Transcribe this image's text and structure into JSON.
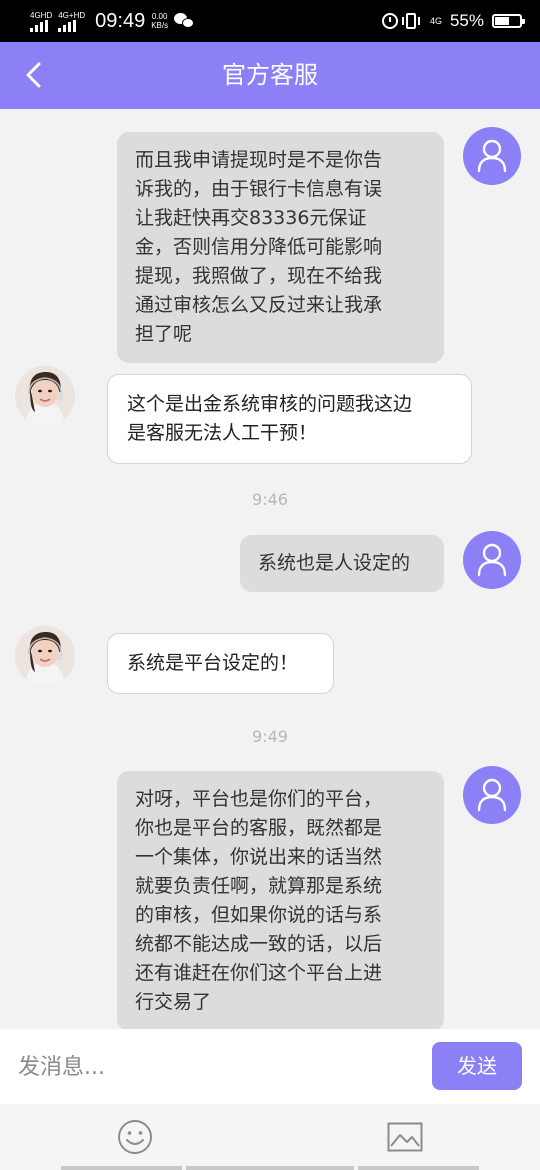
{
  "status_bar": {
    "network1": "4GHD",
    "network2": "4G+HD",
    "time": "09:49",
    "speed_value": "0.00",
    "speed_unit": "KB/s",
    "network_type": "4G",
    "battery_percent": "55%",
    "icons": [
      "signal-icon",
      "wechat-icon",
      "alarm-icon",
      "vibrate-icon",
      "battery-icon"
    ]
  },
  "header": {
    "title": "官方客服",
    "back_icon": "chevron-left-icon"
  },
  "messages": [
    {
      "from": "user",
      "lines": [
        "而且我申请提现时是不是你告",
        "诉我的，由于银行卡信息有误",
        "让我赶快再交83336元保证",
        "金，否则信用分降低可能影响",
        "提现，我照做了，现在不给我",
        "通过审核怎么又反过来让我承",
        "担了呢"
      ]
    },
    {
      "from": "agent",
      "lines": [
        "这个是出金系统审核的问题我这边",
        "是客服无法人工干预！"
      ]
    },
    {
      "time": "9:46"
    },
    {
      "from": "user",
      "lines": [
        "系统也是人设定的"
      ]
    },
    {
      "from": "agent",
      "lines": [
        "系统是平台设定的！"
      ]
    },
    {
      "time": "9:49"
    },
    {
      "from": "user",
      "lines": [
        "对呀，平台也是你们的平台，",
        "你也是平台的客服，既然都是",
        "一个集体，你说出来的话当然",
        "就要负责任啊，就算那是系统",
        "的审核，但如果你说的话与系",
        "统都不能达成一致的话，以后",
        "还有谁赶在你们这个平台上进",
        "行交易了"
      ]
    }
  ],
  "input_bar": {
    "placeholder": "发消息...",
    "send_label": "发送"
  },
  "toolbar": {
    "icons": [
      "emoji-icon",
      "image-icon"
    ]
  },
  "colors": {
    "accent": "#8b80f6",
    "user_bubble": "#dcdcdc",
    "agent_bubble": "#ffffff",
    "background": "#f2f2f2"
  }
}
